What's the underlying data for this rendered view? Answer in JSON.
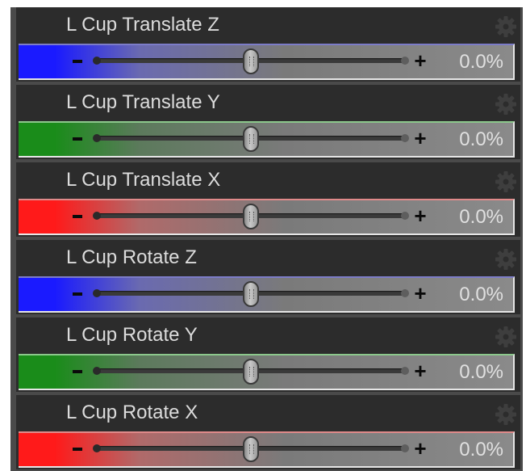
{
  "rows": [
    {
      "label": "L Cup Translate Z",
      "value": "0.0%",
      "slider_fraction": 0.5,
      "color": "#1a1aff",
      "fade": "#6a6ab0",
      "edge": "#7c7cc8",
      "plus": "+",
      "minus": "−"
    },
    {
      "label": "L Cup Translate Y",
      "value": "0.0%",
      "slider_fraction": 0.5,
      "color": "#1a8c1a",
      "fade": "#5c7a5c",
      "edge": "#8cc88c",
      "plus": "+",
      "minus": "−"
    },
    {
      "label": "L Cup Translate X",
      "value": "0.0%",
      "slider_fraction": 0.5,
      "color": "#ff1a1a",
      "fade": "#b06a6a",
      "edge": "#e08a8a",
      "plus": "+",
      "minus": "−"
    },
    {
      "label": "L Cup Rotate Z",
      "value": "0.0%",
      "slider_fraction": 0.5,
      "color": "#1a1aff",
      "fade": "#6a6ab0",
      "edge": "#7c7cc8",
      "plus": "+",
      "minus": "−"
    },
    {
      "label": "L Cup Rotate Y",
      "value": "0.0%",
      "slider_fraction": 0.5,
      "color": "#1a8c1a",
      "fade": "#5c7a5c",
      "edge": "#8cc88c",
      "plus": "+",
      "minus": "−"
    },
    {
      "label": "L Cup Rotate X",
      "value": "0.0%",
      "slider_fraction": 0.5,
      "color": "#ff1a1a",
      "fade": "#b06a6a",
      "edge": "#e08a8a",
      "plus": "+",
      "minus": "−"
    }
  ],
  "icons": {
    "settings": "gear-icon"
  }
}
